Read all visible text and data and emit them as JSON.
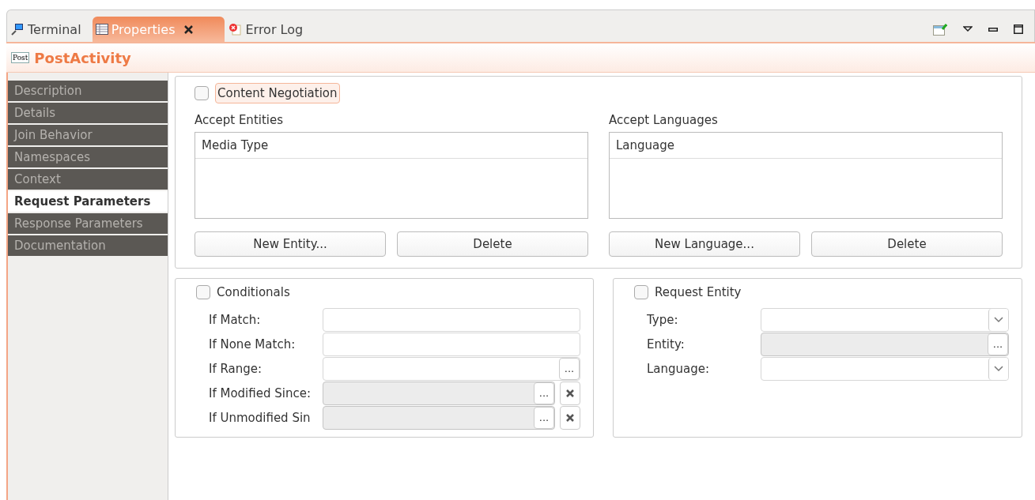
{
  "tabs": [
    {
      "label": "Terminal",
      "kind": "terminal",
      "selected": false
    },
    {
      "label": "Properties",
      "kind": "properties",
      "selected": true
    },
    {
      "label": "Error Log",
      "kind": "error",
      "selected": false
    }
  ],
  "header": {
    "icon_text": "Post",
    "title": "PostActivity"
  },
  "sidebar": {
    "items": [
      {
        "label": "Description",
        "selected": false
      },
      {
        "label": "Details",
        "selected": false
      },
      {
        "label": "Join Behavior",
        "selected": false
      },
      {
        "label": "Namespaces",
        "selected": false
      },
      {
        "label": "Context",
        "selected": false
      },
      {
        "label": "Request Parameters",
        "selected": true
      },
      {
        "label": "Response Parameters",
        "selected": false
      },
      {
        "label": "Documentation",
        "selected": false
      }
    ]
  },
  "negotiation": {
    "checkbox": {
      "label": "Content Negotiation",
      "checked": false
    },
    "lists": [
      {
        "title": "Accept Entities",
        "column": "Media Type",
        "buttons": [
          "New Entity...",
          "Delete"
        ]
      },
      {
        "title": "Accept Languages",
        "column": "Language",
        "buttons": [
          "New Language...",
          "Delete"
        ]
      }
    ]
  },
  "groups": [
    {
      "checkbox": {
        "label": "Conditionals",
        "checked": false
      },
      "fields": [
        {
          "label": "If Match:",
          "kind": "text",
          "disabled": false
        },
        {
          "label": "If None Match:",
          "kind": "text",
          "disabled": false
        },
        {
          "label": "If Range:",
          "kind": "browse",
          "disabled": false,
          "button": "..."
        },
        {
          "label": "If Modified Since:",
          "kind": "browse-clear",
          "disabled": true,
          "button": "..."
        },
        {
          "label": "If Unmodified Sin",
          "kind": "browse-clear",
          "disabled": true,
          "button": "..."
        }
      ]
    },
    {
      "checkbox": {
        "label": "Request Entity",
        "checked": false
      },
      "fields": [
        {
          "label": "Type:",
          "kind": "combo",
          "disabled": false
        },
        {
          "label": "Entity:",
          "kind": "browse",
          "disabled": true,
          "button": "..."
        },
        {
          "label": "Language:",
          "kind": "combo",
          "disabled": false
        }
      ]
    }
  ]
}
